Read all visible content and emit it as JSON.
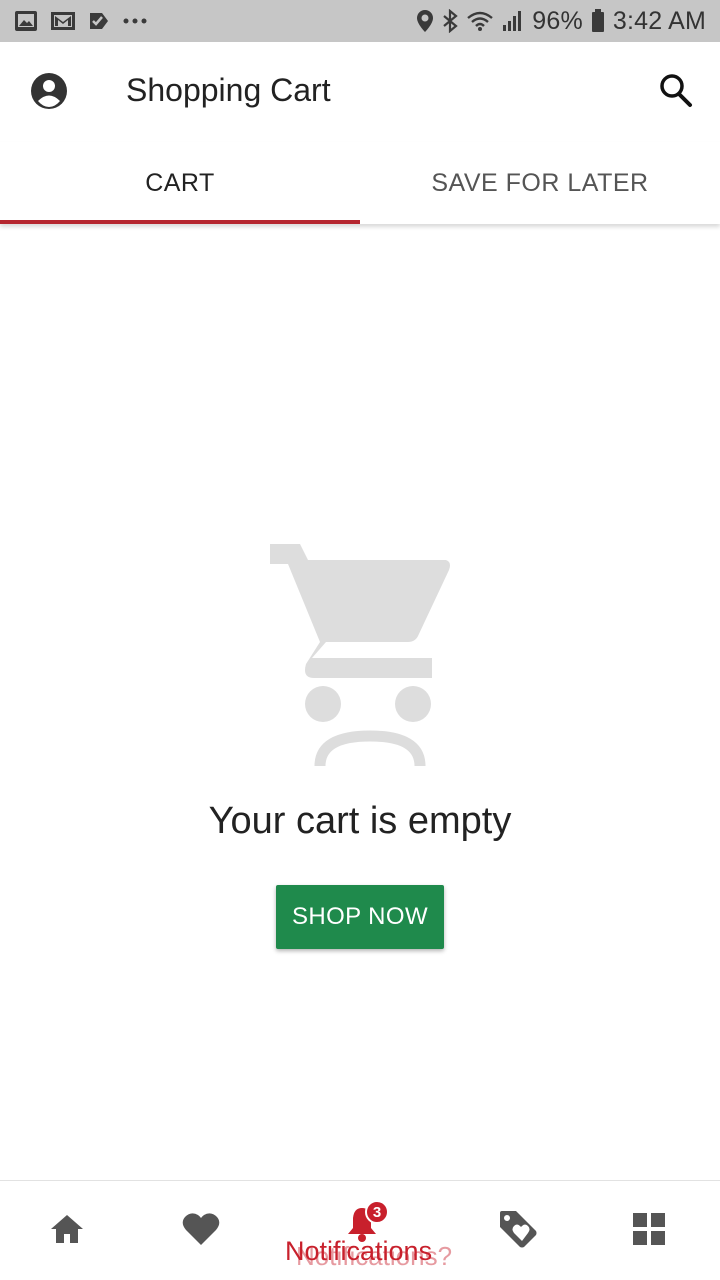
{
  "status_bar": {
    "battery": "96%",
    "time": "3:42 AM",
    "icons": [
      "image-icon",
      "gmail-icon",
      "task-icon",
      "more-dots-icon",
      "location-icon",
      "bluetooth-icon",
      "wifi-icon",
      "signal-icon",
      "battery-icon"
    ]
  },
  "app_bar": {
    "title": "Shopping Cart",
    "icons": [
      "account-icon",
      "search-icon"
    ]
  },
  "tabs": [
    {
      "label": "CART",
      "selected": true
    },
    {
      "label": "SAVE FOR LATER",
      "selected": false
    }
  ],
  "empty_state": {
    "illustration": "sad-cart-icon",
    "title": "Your cart is empty",
    "button_label": "SHOP NOW"
  },
  "bottom_nav": {
    "items": [
      {
        "icon": "home-icon"
      },
      {
        "icon": "heart-icon"
      },
      {
        "icon": "bell-icon",
        "badge": "3",
        "label": "Notifications",
        "overlay_text": "Notifications?"
      },
      {
        "icon": "tag-heart-icon"
      },
      {
        "icon": "grid-icon"
      }
    ]
  },
  "colors": {
    "accent": "#b5262f",
    "primary_button": "#1f8a4c",
    "status_bar": "#c6c6c6",
    "illustration": "#dddddd",
    "nav_icon": "#555555"
  }
}
